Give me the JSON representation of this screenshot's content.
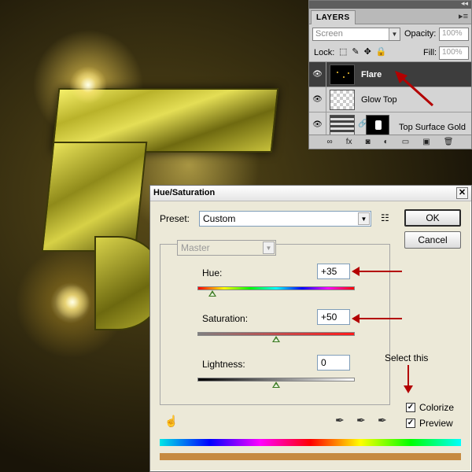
{
  "layers_panel": {
    "collapse_glyph": "◂◂",
    "tab_label": "LAYERS",
    "menu_glyph": "▸≡",
    "blend_mode": "Screen",
    "opacity_label": "Opacity:",
    "opacity_value": "100%",
    "lock_label": "Lock:",
    "fill_label": "Fill:",
    "fill_value": "100%",
    "layers": [
      {
        "name": "Flare",
        "visible": true,
        "selected": true
      },
      {
        "name": "Glow Top",
        "visible": true,
        "selected": false
      },
      {
        "name": "Top Surface Gold",
        "visible": true,
        "selected": false
      }
    ],
    "footer_icons": [
      "link-icon",
      "fx-icon",
      "mask-icon",
      "adjustment-icon",
      "group-icon",
      "new-layer-icon",
      "trash-icon"
    ],
    "footer_glyphs": [
      "∞",
      "fx",
      "◙",
      "◐",
      "▭",
      "▣",
      "🗑"
    ]
  },
  "dialog": {
    "title": "Hue/Saturation",
    "close_glyph": "✕",
    "preset_label": "Preset:",
    "preset_value": "Custom",
    "ok_label": "OK",
    "cancel_label": "Cancel",
    "channel_value": "Master",
    "hue_label": "Hue:",
    "hue_value": "+35",
    "saturation_label": "Saturation:",
    "saturation_value": "+50",
    "lightness_label": "Lightness:",
    "lightness_value": "0",
    "hue_level_fraction": 0.097,
    "saturation_level_fraction": 0.5,
    "lightness_level_fraction": 0.5,
    "colorize_label": "Colorize",
    "colorize_checked": true,
    "preview_label": "Preview",
    "preview_checked": true,
    "annotation_text": "Select this",
    "colorize_bar_color": "#c68a40"
  }
}
